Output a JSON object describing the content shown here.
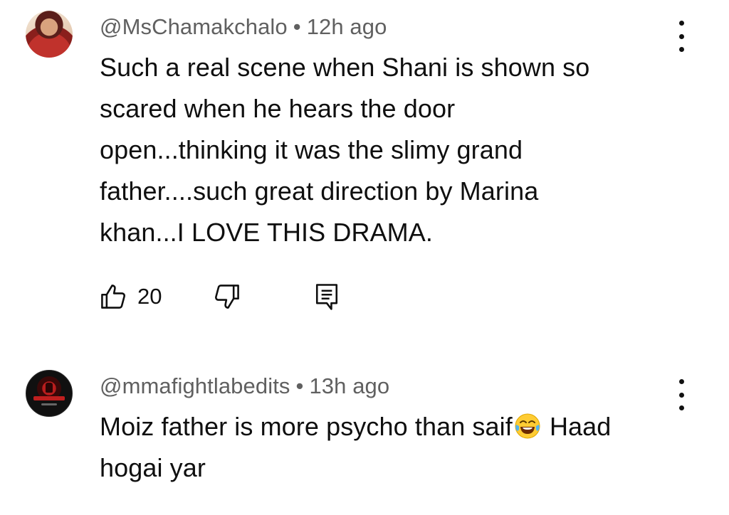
{
  "comments": [
    {
      "handle": "@MsChamakchalo",
      "separator": "•",
      "time": "12h ago",
      "lines": [
        "Such a real scene when Shani is shown so",
        "scared when he hears the door",
        "open...thinking it was the slimy grand",
        "father....such great direction by Marina",
        "khan...I LOVE THIS DRAMA."
      ],
      "like_count": "20",
      "icons": {
        "like": "thumbs-up-icon",
        "dislike": "thumbs-down-icon",
        "reply": "reply-comment-icon",
        "menu": "more-vertical-icon"
      }
    },
    {
      "handle": "@mmafightlabedits",
      "separator": "•",
      "time": "13h ago",
      "line1_before_emoji": "Moiz father is more psycho than saif",
      "emoji": "face-with-tears-of-joy",
      "line1_after_emoji": " Haad",
      "line2": "hogai yar",
      "icons": {
        "menu": "more-vertical-icon"
      }
    }
  ],
  "colors": {
    "text": "#0f0f0f",
    "meta": "#606060",
    "background": "#ffffff"
  }
}
